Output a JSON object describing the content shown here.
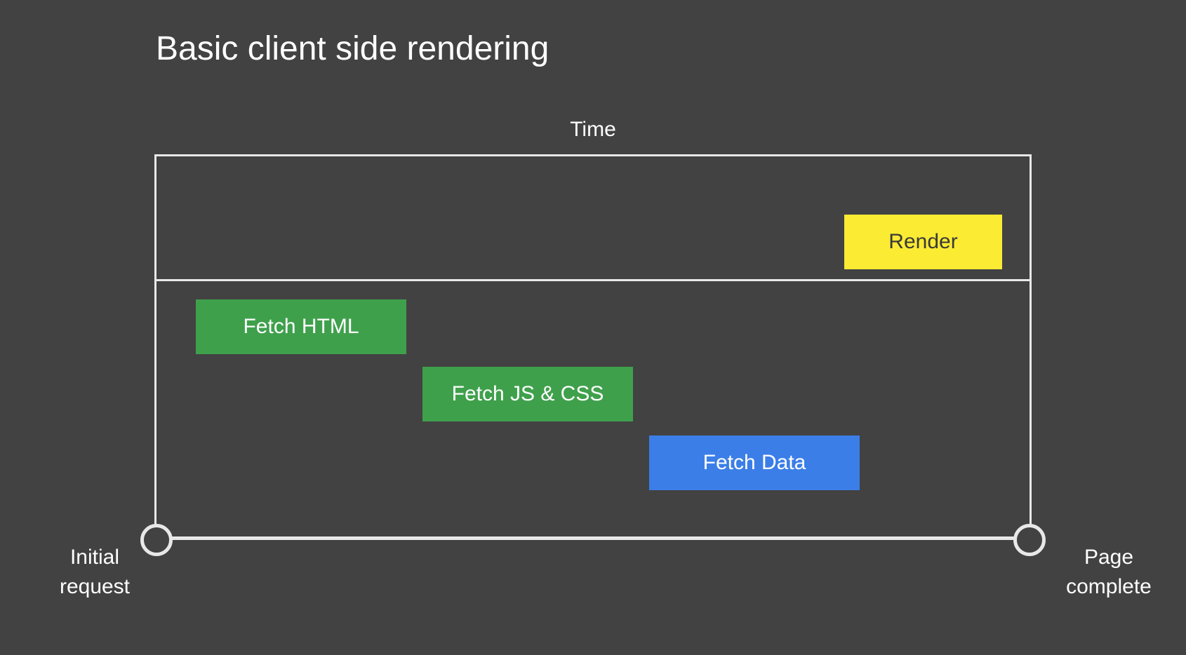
{
  "title": "Basic client side rendering",
  "timeLabel": "Time",
  "bars": {
    "render": "Render",
    "fetchHtml": "Fetch HTML",
    "fetchJs": "Fetch JS & CSS",
    "fetchData": "Fetch Data"
  },
  "labels": {
    "initial": "Initial request",
    "complete": "Page complete"
  },
  "chart_data": {
    "type": "timeline",
    "title": "Basic client side rendering",
    "xlabel": "Time",
    "start_marker": "Initial request",
    "end_marker": "Page complete",
    "tracks": [
      {
        "zone": "upper",
        "bars": [
          {
            "label": "Render",
            "start": 80,
            "end": 98,
            "color": "#fbeb33"
          }
        ]
      },
      {
        "zone": "lower",
        "bars": [
          {
            "label": "Fetch HTML",
            "start": 5,
            "end": 29,
            "color": "#3fa04c"
          },
          {
            "label": "Fetch JS & CSS",
            "start": 31,
            "end": 55,
            "color": "#3fa04c"
          },
          {
            "label": "Fetch Data",
            "start": 57,
            "end": 81,
            "color": "#3b7ee8"
          }
        ]
      }
    ]
  }
}
